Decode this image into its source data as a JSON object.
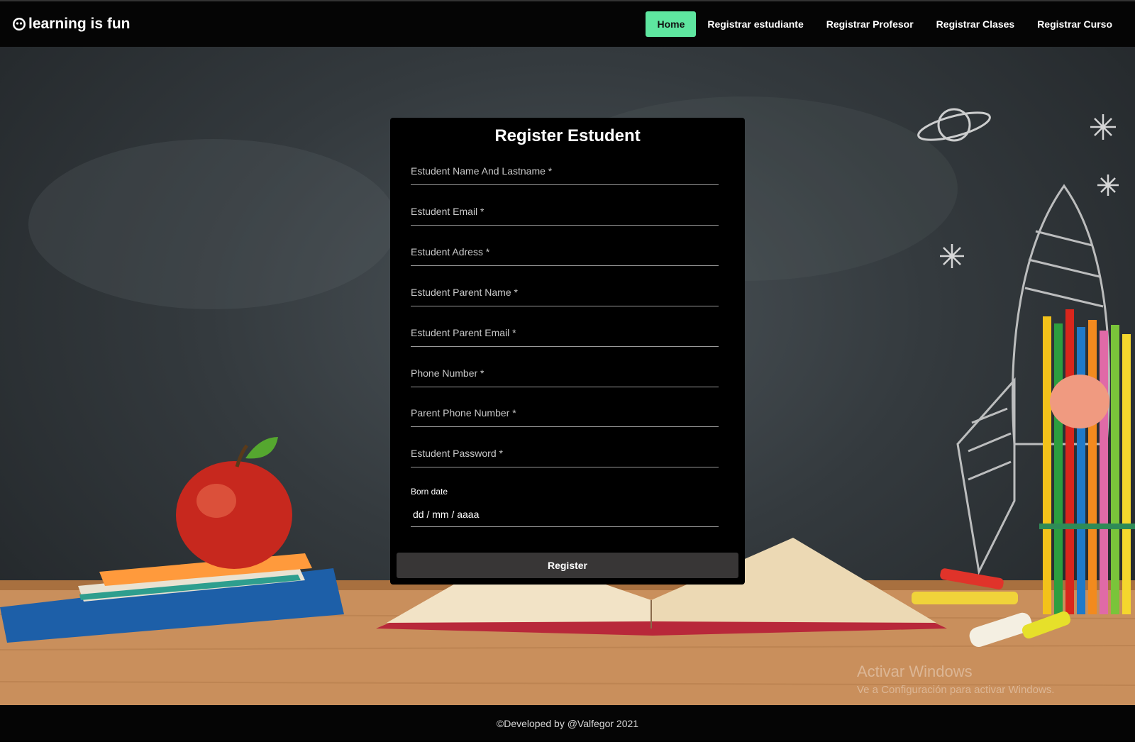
{
  "brand": {
    "name": "learning is fun",
    "icon": "smiley-face-icon"
  },
  "nav": {
    "items": [
      {
        "label": "Home",
        "active": true
      },
      {
        "label": "Registrar estudiante"
      },
      {
        "label": "Registrar Profesor"
      },
      {
        "label": "Registrar Clases"
      },
      {
        "label": "Registrar Curso"
      }
    ],
    "active_color": "#5ee6a0"
  },
  "form": {
    "title": "Register Estudent",
    "fields": [
      {
        "label": "Estudent Name And Lastname *"
      },
      {
        "label": "Estudent Email *"
      },
      {
        "label": "Estudent Adress *"
      },
      {
        "label": "Estudent Parent Name *"
      },
      {
        "label": "Estudent Parent Email *"
      },
      {
        "label": "Phone Number *"
      },
      {
        "label": "Parent Phone Number *"
      },
      {
        "label": "Estudent Password *"
      }
    ],
    "born_date": {
      "label": "Born date",
      "placeholder": "dd / mm / aaaa"
    },
    "submit_label": "Register"
  },
  "watermark": {
    "line1": "Activar Windows",
    "line2": "Ve a Configuración para activar Windows."
  },
  "footer": {
    "text": "©Developed by @Valfegor 2021"
  }
}
